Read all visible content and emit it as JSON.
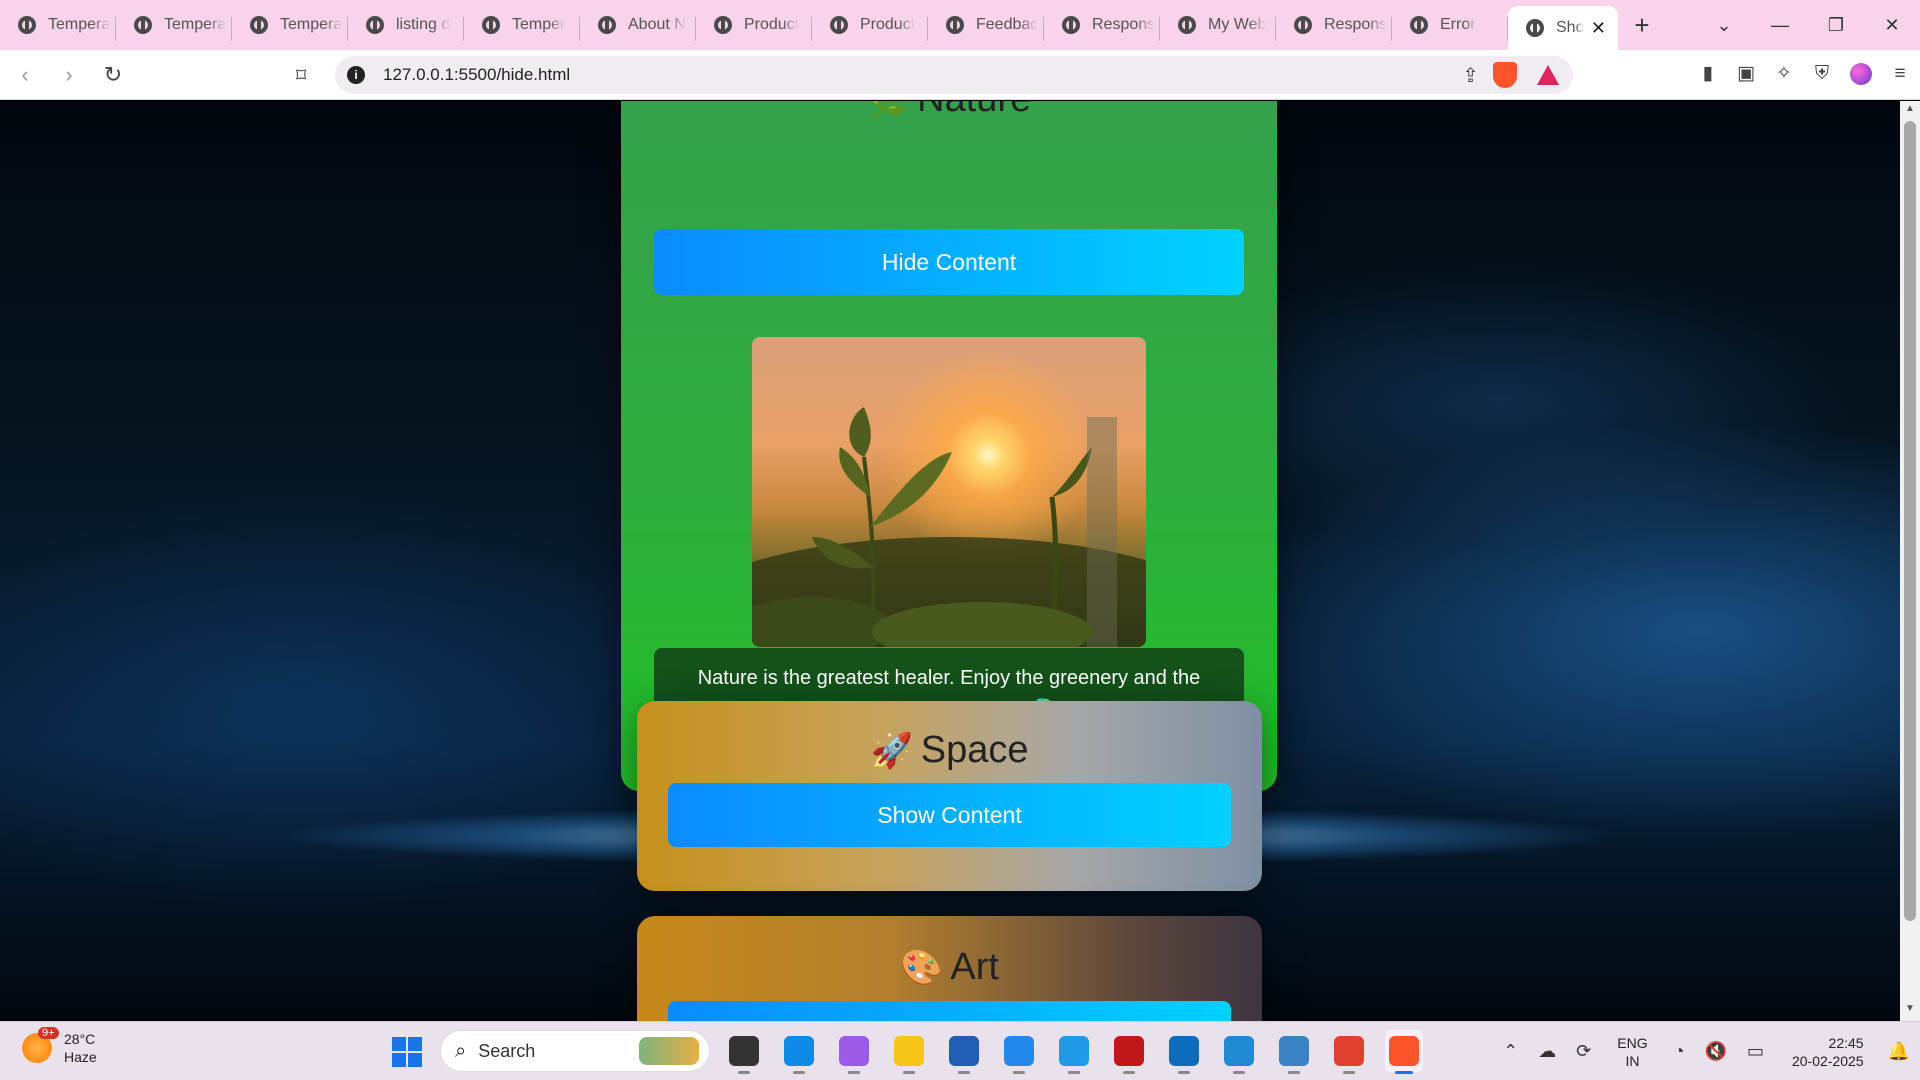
{
  "browser": {
    "tabs": [
      {
        "title": "Tempera",
        "active": false
      },
      {
        "title": "Tempera",
        "active": false
      },
      {
        "title": "Tempera",
        "active": false
      },
      {
        "title": "listing d",
        "active": false
      },
      {
        "title": "Temper",
        "active": false
      },
      {
        "title": "About N",
        "active": false
      },
      {
        "title": "Product",
        "active": false
      },
      {
        "title": "Product",
        "active": false
      },
      {
        "title": "Feedbac",
        "active": false
      },
      {
        "title": "Respons",
        "active": false
      },
      {
        "title": "My Web",
        "active": false
      },
      {
        "title": "Respons",
        "active": false
      },
      {
        "title": "Error",
        "active": false
      },
      {
        "title": "Sho",
        "active": true
      }
    ],
    "new_tab_label": "+",
    "tab_search_icon": "chevron-down",
    "minimize_label": "—",
    "restore_label": "❐",
    "close_label": "✕",
    "back_label": "‹",
    "forward_label": "›",
    "reload_label": "↻",
    "bookmark_label": "🔖",
    "url": "127.0.0.1:5500/hide.html",
    "info_label": "i",
    "share_label": "⇪",
    "sidebar_label": "▮",
    "wallet_label": "▣",
    "ai_label": "✧",
    "vpn_label": "⛨",
    "menu_label": "≡"
  },
  "page": {
    "sections": [
      {
        "key": "nature",
        "emoji": "🌿",
        "title": "Nature",
        "button_label": "Hide Content",
        "expanded": true,
        "description": "Nature is the greatest healer. Enjoy the greenery and the beauty of our planet. 🌍"
      },
      {
        "key": "space",
        "emoji": "🚀",
        "title": "Space",
        "button_label": "Show Content",
        "expanded": false
      },
      {
        "key": "art",
        "emoji": "🎨",
        "title": "Art",
        "button_label": "",
        "expanded": false
      }
    ],
    "accent_gradient": [
      "#0a8bff",
      "#00d2ff"
    ]
  },
  "taskbar": {
    "weather": {
      "temp": "28°C",
      "condition": "Haze",
      "badge": "9+"
    },
    "search_placeholder": "Search",
    "apps": [
      {
        "name": "task-view",
        "color": "#333333",
        "active": false
      },
      {
        "name": "edge",
        "color": "#0c8ce9",
        "active": false
      },
      {
        "name": "copilot",
        "color": "#9b5de5",
        "active": false
      },
      {
        "name": "file-explorer",
        "color": "#f5c518",
        "active": false
      },
      {
        "name": "microsoft-store",
        "color": "#1e5fb5",
        "active": false
      },
      {
        "name": "mahjong",
        "color": "#2288ee",
        "active": false
      },
      {
        "name": "help",
        "color": "#1f9be8",
        "active": false
      },
      {
        "name": "mcafee",
        "color": "#c01818",
        "active": false
      },
      {
        "name": "outlook",
        "color": "#0f6cbd",
        "active": false
      },
      {
        "name": "vscode",
        "color": "#1f8ad2",
        "active": false
      },
      {
        "name": "photos",
        "color": "#3b82c4",
        "active": false
      },
      {
        "name": "chrome",
        "color": "#e0402e",
        "active": false
      },
      {
        "name": "brave",
        "color": "#fb542b",
        "active": true
      }
    ],
    "tray": {
      "chevron": "⌃",
      "lang_top": "ENG",
      "lang_bottom": "IN",
      "wifi": "◔",
      "volume": "🔇",
      "battery": "▭",
      "time": "22:45",
      "date": "20-02-2025",
      "bell": "🔔"
    }
  }
}
